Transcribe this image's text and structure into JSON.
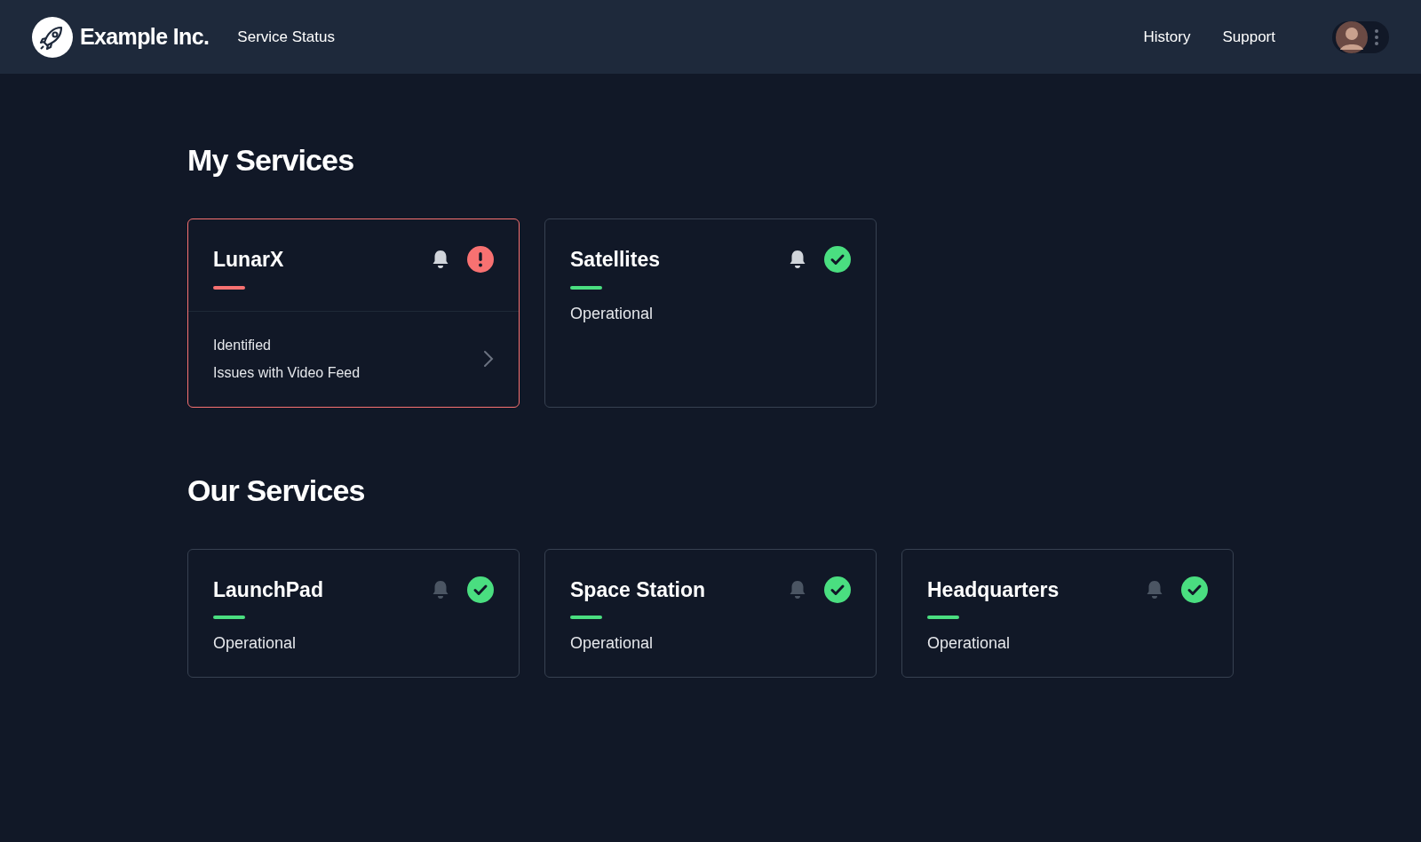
{
  "header": {
    "brand": "Example Inc.",
    "subtitle": "Service Status",
    "nav": [
      {
        "label": "History"
      },
      {
        "label": "Support"
      }
    ]
  },
  "sections": [
    {
      "title": "My Services",
      "services": [
        {
          "name": "LunarX",
          "kind": "incident",
          "subscribed": true,
          "incident": {
            "state": "Identified",
            "title": "Issues with Video Feed"
          }
        },
        {
          "name": "Satellites",
          "kind": "operational",
          "subscribed": true,
          "status_text": "Operational"
        }
      ]
    },
    {
      "title": "Our Services",
      "services": [
        {
          "name": "LaunchPad",
          "kind": "operational",
          "subscribed": false,
          "status_text": "Operational"
        },
        {
          "name": "Space Station",
          "kind": "operational",
          "subscribed": false,
          "status_text": "Operational"
        },
        {
          "name": "Headquarters",
          "kind": "operational",
          "subscribed": false,
          "status_text": "Operational"
        }
      ]
    }
  ]
}
